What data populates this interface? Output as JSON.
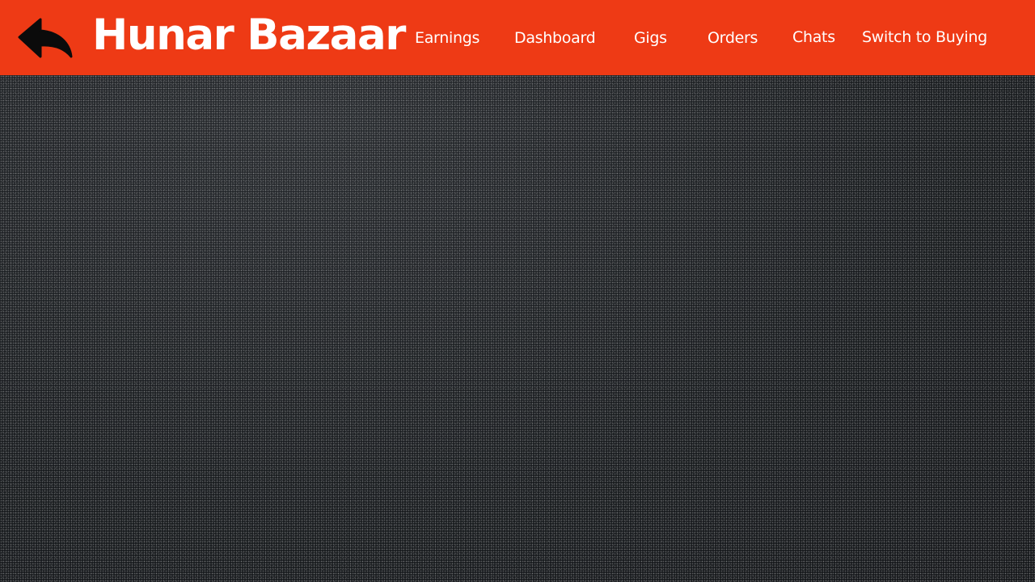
{
  "header": {
    "brand": "Hunar Bazaar",
    "back_icon": "reply-arrow-icon",
    "accent_color": "#ee3a15",
    "nav": {
      "earnings": "Earnings",
      "dashboard": "Dashboard",
      "gigs": "Gigs",
      "orders": "Orders",
      "chats": "Chats",
      "switch": "Switch to Buying"
    }
  },
  "background": {
    "color": "#1c1f22",
    "texture": "dark-speckled"
  }
}
